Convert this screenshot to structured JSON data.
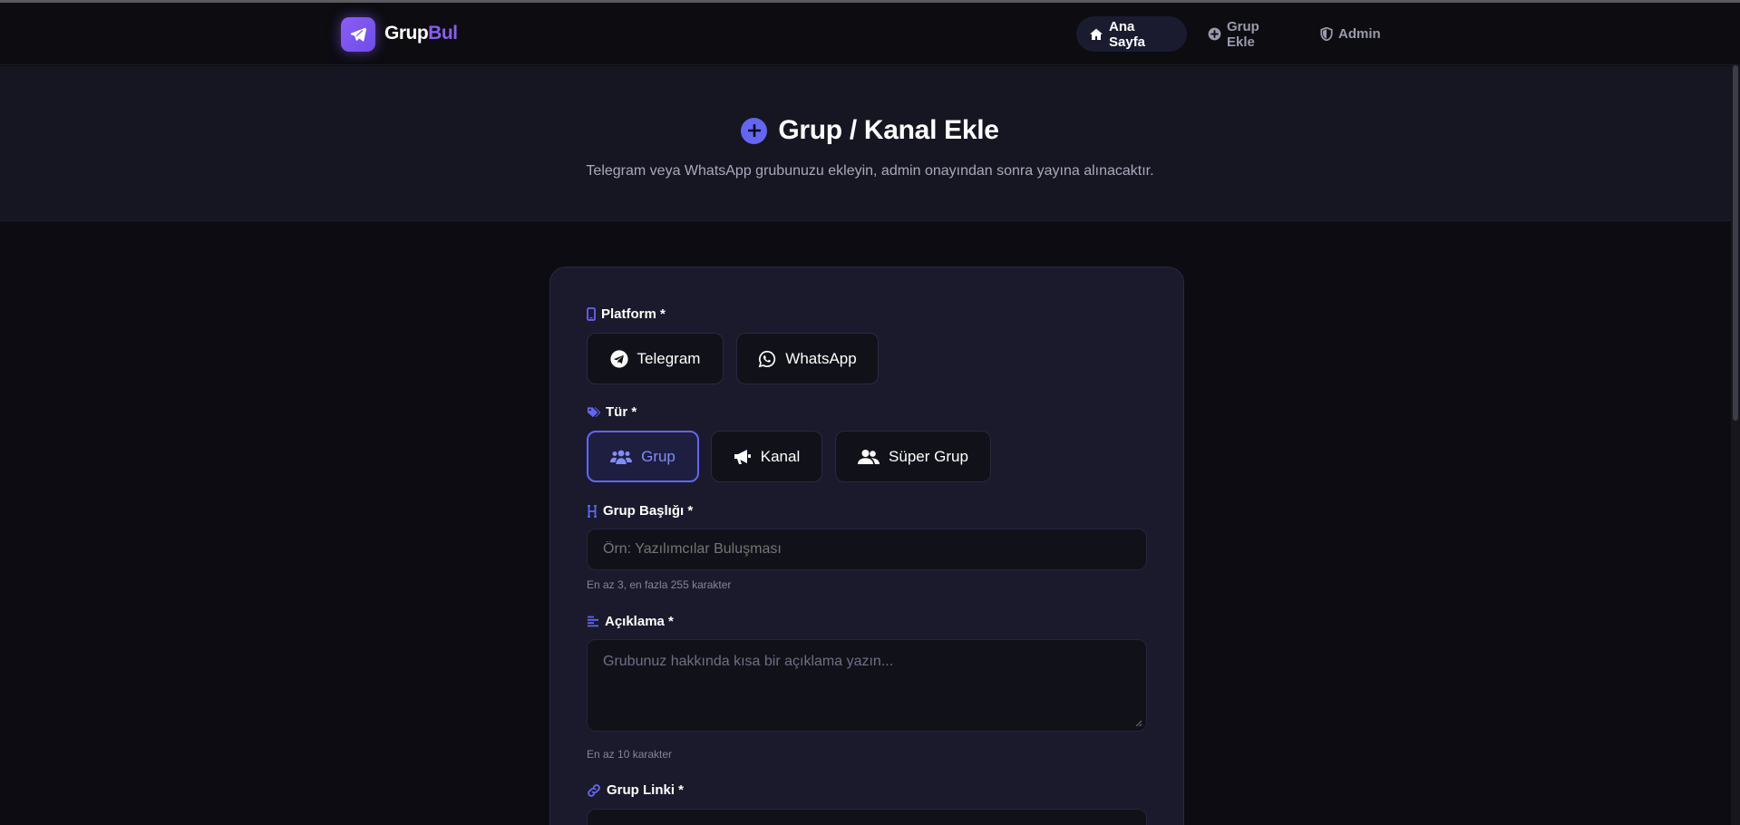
{
  "nav": {
    "brand_a": "Grup",
    "brand_b": "Bul",
    "items": [
      {
        "label": "Ana Sayfa",
        "icon": "home-icon",
        "active": true
      },
      {
        "label": "Grup Ekle",
        "icon": "plus-circle-icon",
        "active": false
      },
      {
        "label": "Admin",
        "icon": "shield-icon",
        "active": false
      }
    ]
  },
  "hero": {
    "title": "Grup / Kanal Ekle",
    "subtitle": "Telegram veya WhatsApp grubunuzu ekleyin, admin onayından sonra yayına alınacaktır."
  },
  "form": {
    "platform": {
      "label": "Platform *",
      "options": [
        {
          "label": "Telegram",
          "icon": "telegram-icon",
          "selected": false
        },
        {
          "label": "WhatsApp",
          "icon": "whatsapp-icon",
          "selected": false
        }
      ]
    },
    "type": {
      "label": "Tür *",
      "options": [
        {
          "label": "Grup",
          "icon": "users-icon",
          "selected": true
        },
        {
          "label": "Kanal",
          "icon": "megaphone-icon",
          "selected": false
        },
        {
          "label": "Süper Grup",
          "icon": "user-group-icon",
          "selected": false
        }
      ]
    },
    "title": {
      "label": "Grup Başlığı *",
      "placeholder": "Örn: Yazılımcılar Buluşması",
      "value": "",
      "hint": "En az 3, en fazla 255 karakter"
    },
    "description": {
      "label": "Açıklama *",
      "placeholder": "Grubunuz hakkında kısa bir açıklama yazın...",
      "value": "",
      "hint": "En az 10 karakter"
    },
    "link": {
      "label": "Grup Linki *"
    }
  },
  "colors": {
    "accent": "#6366f1",
    "brand_purple": "#8b5cf6",
    "background": "#0c0c12",
    "card": "#1a1a2c"
  }
}
